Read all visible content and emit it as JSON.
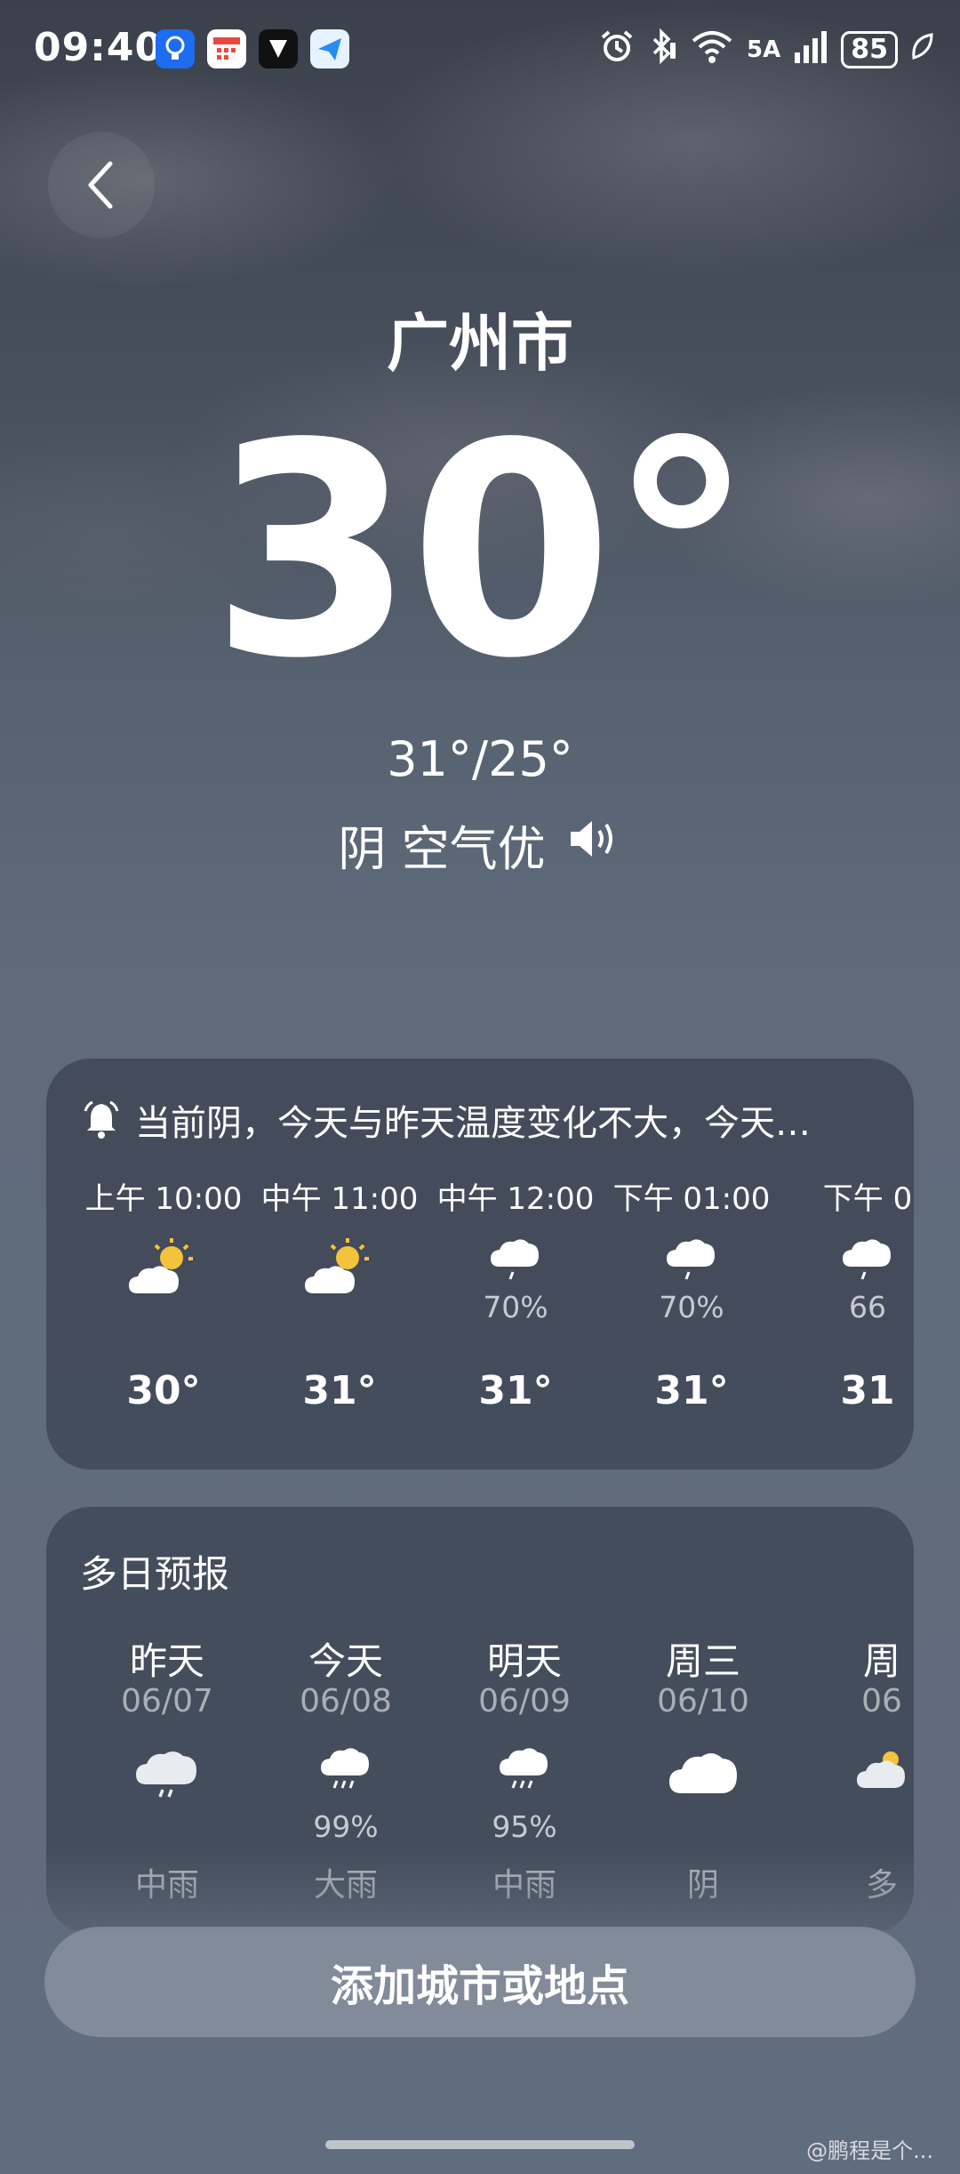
{
  "status_bar": {
    "time": "09:40",
    "network": "5A",
    "battery": "85"
  },
  "header": {
    "city": "广州市",
    "temperature": "30°",
    "high_low": "31°/25°",
    "condition": "阴 空气优"
  },
  "hourly": {
    "alert": "当前阴，今天与昨天温度变化不大，今天…",
    "items": [
      {
        "time": "上午 10:00",
        "icon": "partly-cloudy-day-icon",
        "pop": "",
        "temp": "30°"
      },
      {
        "time": "中午 11:00",
        "icon": "partly-cloudy-day-icon",
        "pop": "",
        "temp": "31°"
      },
      {
        "time": "中午 12:00",
        "icon": "rain-cloud-icon",
        "pop": "70%",
        "temp": "31°"
      },
      {
        "time": "下午 01:00",
        "icon": "rain-cloud-icon",
        "pop": "70%",
        "temp": "31°"
      },
      {
        "time": "下午 0",
        "icon": "rain-cloud-icon",
        "pop": "66",
        "temp": "31"
      }
    ]
  },
  "forecast": {
    "title": "多日预报",
    "days": [
      {
        "name": "昨天",
        "date": "06/07",
        "icon": "moderate-rain-icon",
        "pop": "",
        "cond": "中雨"
      },
      {
        "name": "今天",
        "date": "06/08",
        "icon": "heavy-rain-icon",
        "pop": "99%",
        "cond": "大雨"
      },
      {
        "name": "明天",
        "date": "06/09",
        "icon": "moderate-rain-icon",
        "pop": "95%",
        "cond": "中雨"
      },
      {
        "name": "周三",
        "date": "06/10",
        "icon": "overcast-cloud-icon",
        "pop": "",
        "cond": "阴"
      },
      {
        "name": "周",
        "date": "06",
        "icon": "partly-cloudy-icon",
        "pop": "",
        "cond": "多"
      }
    ]
  },
  "add_button_label": "添加城市或地点",
  "watermark": "@鹏程是个..."
}
